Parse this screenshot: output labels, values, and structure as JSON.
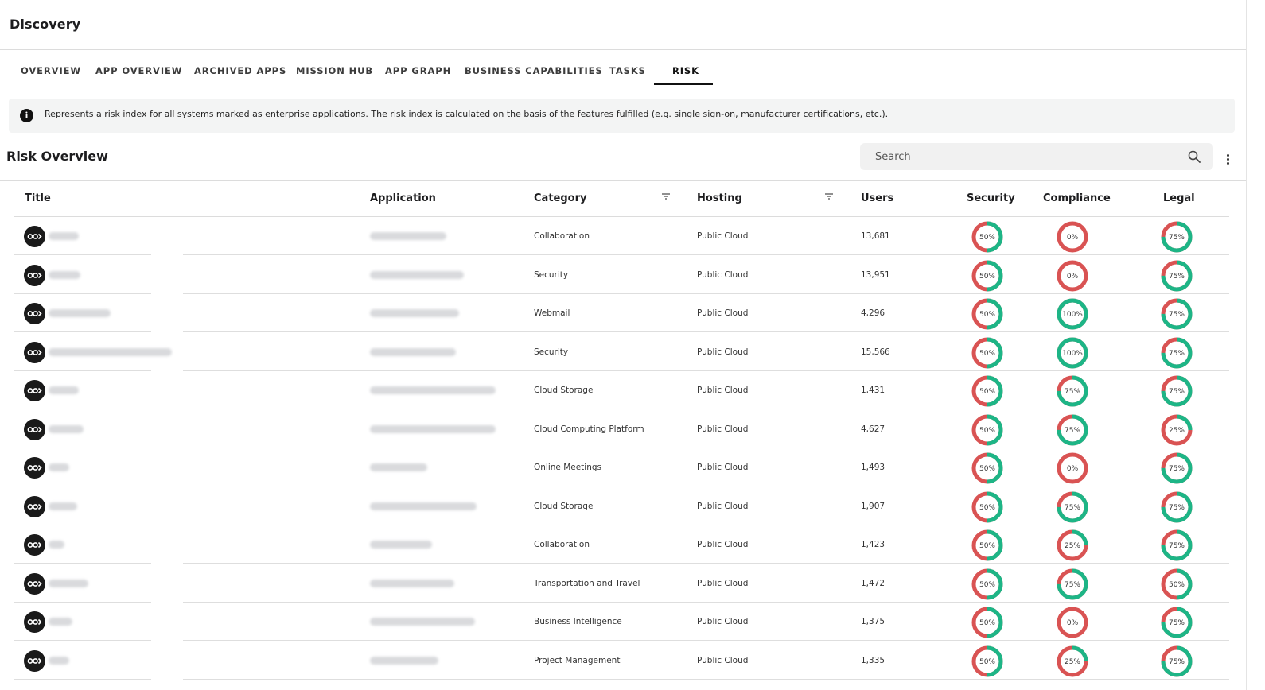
{
  "app_title": "Discovery",
  "tabs": [
    {
      "label": "OVERVIEW",
      "active": false
    },
    {
      "label": "APP OVERVIEW",
      "active": false
    },
    {
      "label": "ARCHIVED APPS",
      "active": false
    },
    {
      "label": "MISSION HUB",
      "active": false
    },
    {
      "label": "APP GRAPH",
      "active": false
    },
    {
      "label": "BUSINESS CAPABILITIES",
      "active": false
    },
    {
      "label": "TASKS",
      "active": false
    },
    {
      "label": "RISK",
      "active": true
    }
  ],
  "info": {
    "icon": "info-icon",
    "text": "Represents a risk index for all systems marked as enterprise applications. The risk index is calculated on the basis of the features fulfilled (e.g. single sign-on, manufacturer certifications, etc.)."
  },
  "section_title": "Risk Overview",
  "search": {
    "placeholder": "Search",
    "value": ""
  },
  "columns": {
    "title": "Title",
    "application": "Application",
    "category": "Category",
    "hosting": "Hosting",
    "users": "Users",
    "security": "Security",
    "compliance": "Compliance",
    "legal": "Legal"
  },
  "colors": {
    "ok": "#1db586",
    "risk": "#d95353",
    "text": "#1d1d1f"
  },
  "rows": [
    {
      "category": "Collaboration",
      "hosting": "Public Cloud",
      "users": "13,681",
      "security": 50,
      "compliance": 0,
      "legal": 75
    },
    {
      "category": "Security",
      "hosting": "Public Cloud",
      "users": "13,951",
      "security": 50,
      "compliance": 0,
      "legal": 75
    },
    {
      "category": "Webmail",
      "hosting": "Public Cloud",
      "users": "4,296",
      "security": 50,
      "compliance": 100,
      "legal": 75
    },
    {
      "category": "Security",
      "hosting": "Public Cloud",
      "users": "15,566",
      "security": 50,
      "compliance": 100,
      "legal": 75
    },
    {
      "category": "Cloud Storage",
      "hosting": "Public Cloud",
      "users": "1,431",
      "security": 50,
      "compliance": 75,
      "legal": 75
    },
    {
      "category": "Cloud Computing Platform",
      "hosting": "Public Cloud",
      "users": "4,627",
      "security": 50,
      "compliance": 75,
      "legal": 25
    },
    {
      "category": "Online Meetings",
      "hosting": "Public Cloud",
      "users": "1,493",
      "security": 50,
      "compliance": 0,
      "legal": 75
    },
    {
      "category": "Cloud Storage",
      "hosting": "Public Cloud",
      "users": "1,907",
      "security": 50,
      "compliance": 75,
      "legal": 75
    },
    {
      "category": "Collaboration",
      "hosting": "Public Cloud",
      "users": "1,423",
      "security": 50,
      "compliance": 25,
      "legal": 75
    },
    {
      "category": "Transportation and Travel",
      "hosting": "Public Cloud",
      "users": "1,472",
      "security": 50,
      "compliance": 75,
      "legal": 50
    },
    {
      "category": "Business Intelligence",
      "hosting": "Public Cloud",
      "users": "1,375",
      "security": 50,
      "compliance": 0,
      "legal": 75
    },
    {
      "category": "Project Management",
      "hosting": "Public Cloud",
      "users": "1,335",
      "security": 50,
      "compliance": 25,
      "legal": 75
    }
  ]
}
